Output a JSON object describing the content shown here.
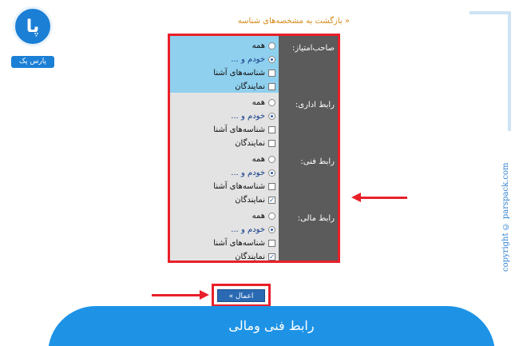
{
  "logo": {
    "mark": "پا",
    "text": "پارس پک"
  },
  "back_link": "« بازگشت به مشخصه‌های شناسه",
  "sections": [
    {
      "label": "صاحب‌امتیاز:",
      "options": [
        {
          "type": "radio",
          "label": "همه",
          "checked": false
        },
        {
          "type": "radio",
          "label": "خودم و ...",
          "checked": true
        },
        {
          "type": "checkbox",
          "label": "شناسه‌های آشنا",
          "checked": false
        },
        {
          "type": "checkbox",
          "label": "نمایندگان",
          "checked": false
        }
      ]
    },
    {
      "label": "رابط اداری:",
      "options": [
        {
          "type": "radio",
          "label": "همه",
          "checked": false
        },
        {
          "type": "radio",
          "label": "خودم و ...",
          "checked": true
        },
        {
          "type": "checkbox",
          "label": "شناسه‌های آشنا",
          "checked": false
        },
        {
          "type": "checkbox",
          "label": "نمایندگان",
          "checked": false
        }
      ]
    },
    {
      "label": "رابط فنی:",
      "options": [
        {
          "type": "radio",
          "label": "همه",
          "checked": false
        },
        {
          "type": "radio",
          "label": "خودم و ...",
          "checked": true
        },
        {
          "type": "checkbox",
          "label": "شناسه‌های آشنا",
          "checked": false
        },
        {
          "type": "checkbox",
          "label": "نمایندگان",
          "checked": true
        }
      ]
    },
    {
      "label": "رابط مالی:",
      "options": [
        {
          "type": "radio",
          "label": "همه",
          "checked": false
        },
        {
          "type": "radio",
          "label": "خودم و ...",
          "checked": true
        },
        {
          "type": "checkbox",
          "label": "شناسه‌های آشنا",
          "checked": false
        },
        {
          "type": "checkbox",
          "label": "نمایندگان",
          "checked": true
        }
      ]
    }
  ],
  "apply_button": "اعمال »",
  "copyright": "copyright © parspack.com",
  "banner_title": "رابط فنی ومالی",
  "colors": {
    "highlight_blue": "#8fd0ee",
    "light_gray": "#e3e3e3",
    "dark_gray": "#5b5b5b",
    "annotation_red": "#e8202a",
    "brand_blue": "#1e93e6"
  }
}
